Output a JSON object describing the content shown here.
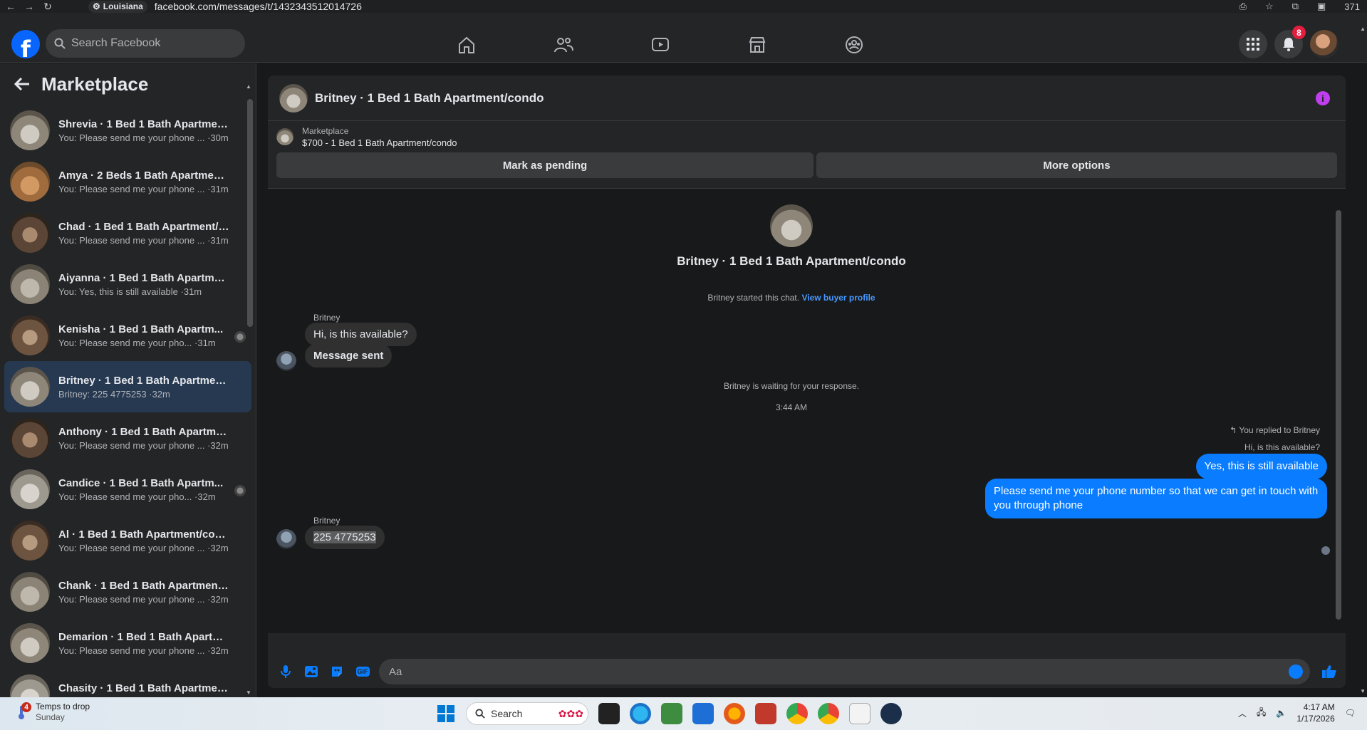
{
  "browser": {
    "site_label": "Louisiana",
    "url": "facebook.com/messages/t/1432343512014726",
    "tab_count": "371"
  },
  "nav": {
    "search_placeholder": "Search Facebook",
    "notification_count": "8"
  },
  "sidebar": {
    "title": "Marketplace",
    "conversations": [
      {
        "name": "Shrevia · 1 Bed 1 Bath Apartment...",
        "preview": "You: Please send me your phone ... ·30m",
        "thumb": "r1"
      },
      {
        "name": "Amya · 2 Beds 1 Bath Apartment...",
        "preview": "You: Please send me your phone ... ·31m",
        "thumb": "r2"
      },
      {
        "name": "Chad · 1 Bed 1 Bath Apartment/c...",
        "preview": "You: Please send me your phone ... ·31m",
        "thumb": "r3"
      },
      {
        "name": "Aiyanna · 1 Bed 1 Bath Apartmen...",
        "preview": "You: Yes, this is still available ·31m",
        "thumb": "r4"
      },
      {
        "name": "Kenisha · 1 Bed 1 Bath Apartm...",
        "preview": "You: Please send me your pho... ·31m",
        "thumb": "r5"
      },
      {
        "name": "Britney · 1 Bed 1 Bath Apartment...",
        "preview": "Britney: 225 4775253 ·32m",
        "thumb": "r1"
      },
      {
        "name": "Anthony · 1 Bed 1 Bath Apartme...",
        "preview": "You: Please send me your phone ... ·32m",
        "thumb": "r3"
      },
      {
        "name": "Candice · 1 Bed 1 Bath Apartm...",
        "preview": "You: Please send me your pho... ·32m",
        "thumb": "r6"
      },
      {
        "name": "Al · 1 Bed 1 Bath Apartment/con...",
        "preview": "You: Please send me your phone ... ·32m",
        "thumb": "r5"
      },
      {
        "name": "Chank · 1 Bed 1 Bath Apartment/...",
        "preview": "You: Please send me your phone ... ·32m",
        "thumb": "r4"
      },
      {
        "name": "Demarion · 1 Bed 1 Bath Apartm...",
        "preview": "You: Please send me your phone ... ·32m",
        "thumb": "r1"
      },
      {
        "name": "Chasity · 1 Bed 1 Bath Apartment...",
        "preview": "You: Please send me your phone ... ·33m",
        "thumb": "r6"
      }
    ]
  },
  "chat": {
    "title": "Britney · 1 Bed 1 Bath Apartment/condo",
    "listing_source": "Marketplace",
    "listing_price_title": "$700 - 1 Bed 1 Bath Apartment/condo",
    "mark_pending_label": "Mark as pending",
    "more_options_label": "More options",
    "intro_title": "Britney · 1 Bed 1 Bath Apartment/condo",
    "started_text": "Britney started this chat.",
    "view_profile_label": "View buyer profile",
    "sender_name": "Britney",
    "msg1": "Hi, is this available?",
    "msg2": "Message sent",
    "waiting_text": "Britney is waiting for your response.",
    "timestamp": "3:44 AM",
    "replied_note": "You replied to Britney",
    "reply_quote": "Hi, is this available?",
    "out1": "Yes, this is still available",
    "out2": "Please send me your phone  number so that we can get in touch with you through phone",
    "sender_name_2": "Britney",
    "msg3": "225 4775253",
    "composer_placeholder": "Aa",
    "gif_label": "GIF"
  },
  "taskbar": {
    "weather_badge": "4",
    "weather_title": "Temps to drop",
    "weather_sub": "Sunday",
    "search_label": "Search",
    "time": "4:17 AM",
    "date": "1/17/2026"
  },
  "colors": {
    "accent": "#0a7cff",
    "fb_blue": "#0866ff",
    "info": "#c13ef0",
    "active_row": "#263951"
  }
}
